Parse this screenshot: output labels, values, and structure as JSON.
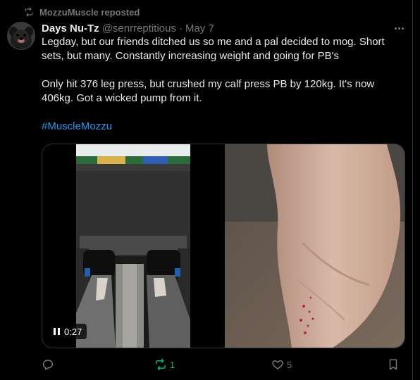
{
  "repost_banner": {
    "text": "MozzuMuscle reposted",
    "icon": "repost-icon"
  },
  "author": {
    "name": "Days Nu-Tz",
    "handle": "@senrreptitious",
    "separator": "·",
    "date": "May 7"
  },
  "post": {
    "paragraph_1": "Legday, but our friends ditched us so me and a pal decided to mog. Short sets, but many. Constantly increasing weight and going for PB's",
    "paragraph_2": "Only hit 376 leg press, but crushed my calf press PB by 120kg. It's now 406kg. Got a wicked pump from it.",
    "hashtag": "#MuscleMozzu"
  },
  "media": {
    "video_time": "0:27"
  },
  "actions": {
    "reply": {
      "icon": "reply-icon",
      "count": ""
    },
    "repost": {
      "icon": "repost-icon",
      "count": "1",
      "color": "#00ba7c"
    },
    "like": {
      "icon": "heart-icon",
      "count": "5"
    },
    "bookmark": {
      "icon": "bookmark-icon",
      "count": ""
    }
  },
  "colors": {
    "background": "#000000",
    "text": "#e7e9ea",
    "muted": "#71767b",
    "link": "#1d9bf0",
    "border": "#2f3336"
  }
}
